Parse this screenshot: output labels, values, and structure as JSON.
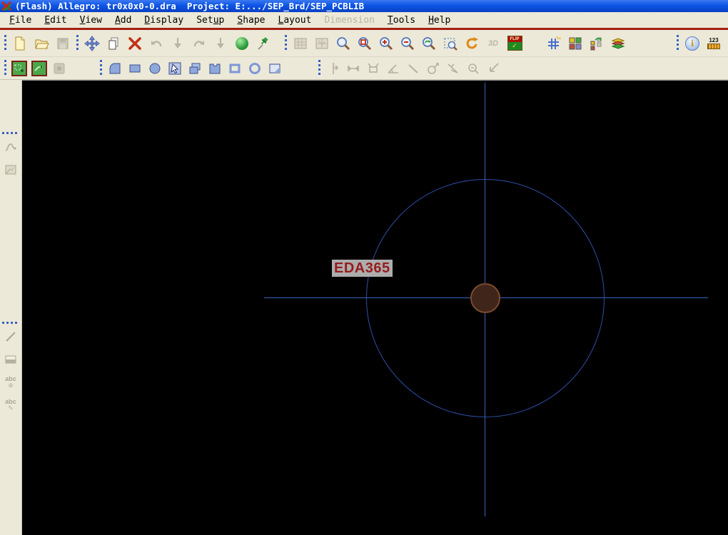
{
  "title_bar": {
    "text": "(Flash) Allegro: tr0x0x0-0.dra  Project: E:.../SEP_Brd/SEP_PCBLIB"
  },
  "menu_bar": {
    "items": [
      {
        "label": "File",
        "mnemonic": 0,
        "disabled": false
      },
      {
        "label": "Edit",
        "mnemonic": 0,
        "disabled": false
      },
      {
        "label": "View",
        "mnemonic": 0,
        "disabled": false
      },
      {
        "label": "Add",
        "mnemonic": 0,
        "disabled": false
      },
      {
        "label": "Display",
        "mnemonic": 0,
        "disabled": false
      },
      {
        "label": "Setup",
        "mnemonic": 3,
        "disabled": false
      },
      {
        "label": "Shape",
        "mnemonic": 0,
        "disabled": false
      },
      {
        "label": "Layout",
        "mnemonic": 0,
        "disabled": false
      },
      {
        "label": "Dimension",
        "mnemonic": -1,
        "disabled": true
      },
      {
        "label": "Tools",
        "mnemonic": 0,
        "disabled": false
      },
      {
        "label": "Help",
        "mnemonic": 0,
        "disabled": false
      }
    ]
  },
  "toolbars": {
    "main_row": {
      "file_group": [
        "new-file",
        "open-file",
        "save-file"
      ],
      "edit_group": [
        "move",
        "copy",
        "delete",
        "undo",
        "cancel",
        "redo",
        "repeat",
        "highlight",
        "pin"
      ],
      "view_group": [
        "rats-all",
        "rats-components",
        "zoom-fit",
        "zoom-points",
        "zoom-in",
        "zoom-out",
        "zoom-previous",
        "zoom-selection",
        "redraw",
        "3d-view",
        "flip-design"
      ],
      "display_group": [
        "grid-toggle",
        "color-dialog",
        "swap-mode",
        "shadow-mode"
      ],
      "right_group": [
        "show-element",
        "show-measure"
      ],
      "disabled_icons": [
        "save-file",
        "undo",
        "cancel",
        "redo",
        "repeat",
        "rats-all",
        "rats-components",
        "3d-view"
      ]
    },
    "shape_row": {
      "pad_group": [
        "pad-designer-a",
        "pad-designer-b",
        "pad-save"
      ],
      "shape_group": [
        "shape-add-arc",
        "shape-add-rect",
        "shape-add-circle",
        "shape-select",
        "shape-copy",
        "shape-polygon",
        "shape-rect-unfilled",
        "shape-circle-unfilled",
        "shape-corner"
      ],
      "dimension_group": [
        "dim-linear",
        "dim-distance",
        "dim-leader",
        "dim-angular",
        "dim-diagonal",
        "dim-diameter",
        "dim-cut",
        "dim-inspect",
        "dim-datum"
      ],
      "disabled_icons": [
        "pad-save",
        "dim-linear",
        "dim-distance",
        "dim-leader",
        "dim-angular",
        "dim-diagonal",
        "dim-diameter",
        "dim-cut",
        "dim-inspect",
        "dim-datum"
      ]
    },
    "icon_text": {
      "flip": "FLIP",
      "three_d": "3D",
      "measure": "123",
      "info": "i",
      "abc": "abc",
      "check": "✓"
    }
  },
  "sidebar": {
    "top_group": [
      "spline-tool",
      "report-tool"
    ],
    "bottom_group": [
      "line-tool",
      "rect-tool",
      "text-add-tool",
      "text-edit-tool"
    ],
    "all_disabled": true
  },
  "canvas": {
    "background": "#000000",
    "label": {
      "text": "EDA365",
      "color": "#971c1c",
      "bg": "#adadad"
    },
    "crosshair_color": "#3c64be",
    "circle_color": "#2e4fa8",
    "pad": {
      "fill": "#40251a",
      "border": "#7b4b2f"
    }
  },
  "colors": {
    "titlebar_blue": "#0d55e6",
    "chrome_beige": "#ece9d8",
    "menu_separator_red": "#a32014",
    "separator_dots_blue": "#3a62c8"
  }
}
